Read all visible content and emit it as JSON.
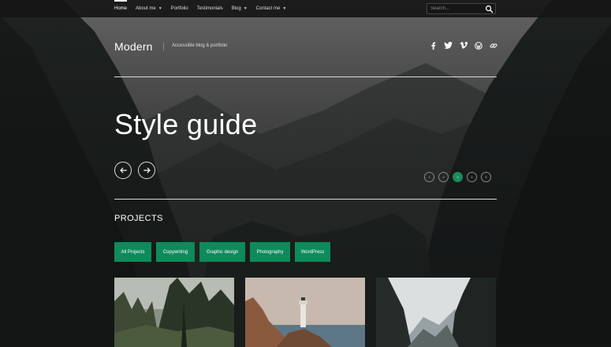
{
  "nav": {
    "items": [
      {
        "label": "Home",
        "active": true,
        "dropdown": false
      },
      {
        "label": "About me",
        "active": false,
        "dropdown": true
      },
      {
        "label": "Portfolio",
        "active": false,
        "dropdown": false
      },
      {
        "label": "Testimonials",
        "active": false,
        "dropdown": false
      },
      {
        "label": "Blog",
        "active": false,
        "dropdown": true
      },
      {
        "label": "Contact me",
        "active": false,
        "dropdown": true
      }
    ],
    "search_placeholder": "Search...",
    "search_icon": "search-icon"
  },
  "header": {
    "brand": "Modern",
    "tagline": "Accessible blog & portfolio",
    "social_icons": [
      "facebook-icon",
      "twitter-icon",
      "vimeo-icon",
      "wordpress-icon",
      "link-icon"
    ]
  },
  "hero": {
    "title": "Style guide",
    "prev_icon": "arrow-left-icon",
    "next_icon": "arrow-right-icon",
    "slide_dots": [
      "1",
      "2",
      "3",
      "4",
      "5"
    ],
    "active_dot": 3
  },
  "projects": {
    "heading": "PROJECTS",
    "filters": [
      "All Projects",
      "Copywriting",
      "Graphic design",
      "Photography",
      "WordPress"
    ]
  },
  "colors": {
    "accent": "#0e8a5b",
    "topbar": "#161616",
    "text": "#ffffff"
  }
}
